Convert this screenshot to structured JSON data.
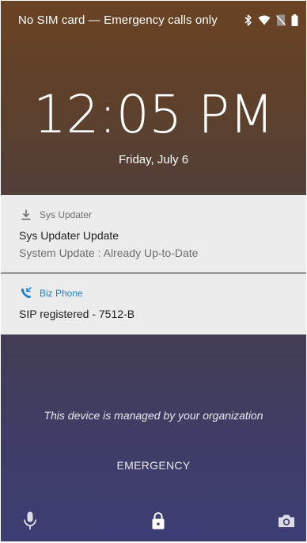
{
  "status_bar": {
    "carrier_text": "No SIM card — Emergency calls only",
    "icons": [
      "bluetooth-icon",
      "wifi-icon",
      "no-sim-icon",
      "battery-icon"
    ]
  },
  "lockscreen": {
    "time": "12:05 PM",
    "date": "Friday, July 6"
  },
  "notifications": [
    {
      "app_name": "Sys Updater",
      "icon": "download-icon",
      "title": "Sys Updater Update",
      "body": "System Update : Already Up-to-Date"
    },
    {
      "app_name": "Biz Phone",
      "icon": "phone-call-icon",
      "accent_color": "#1a7fd4",
      "title": "SIP registered - 7512-B"
    }
  ],
  "managed_notice": "This device is managed by your organization",
  "emergency_label": "EMERGENCY",
  "bottom_actions": [
    "mic-icon",
    "lock-icon",
    "camera-icon"
  ]
}
